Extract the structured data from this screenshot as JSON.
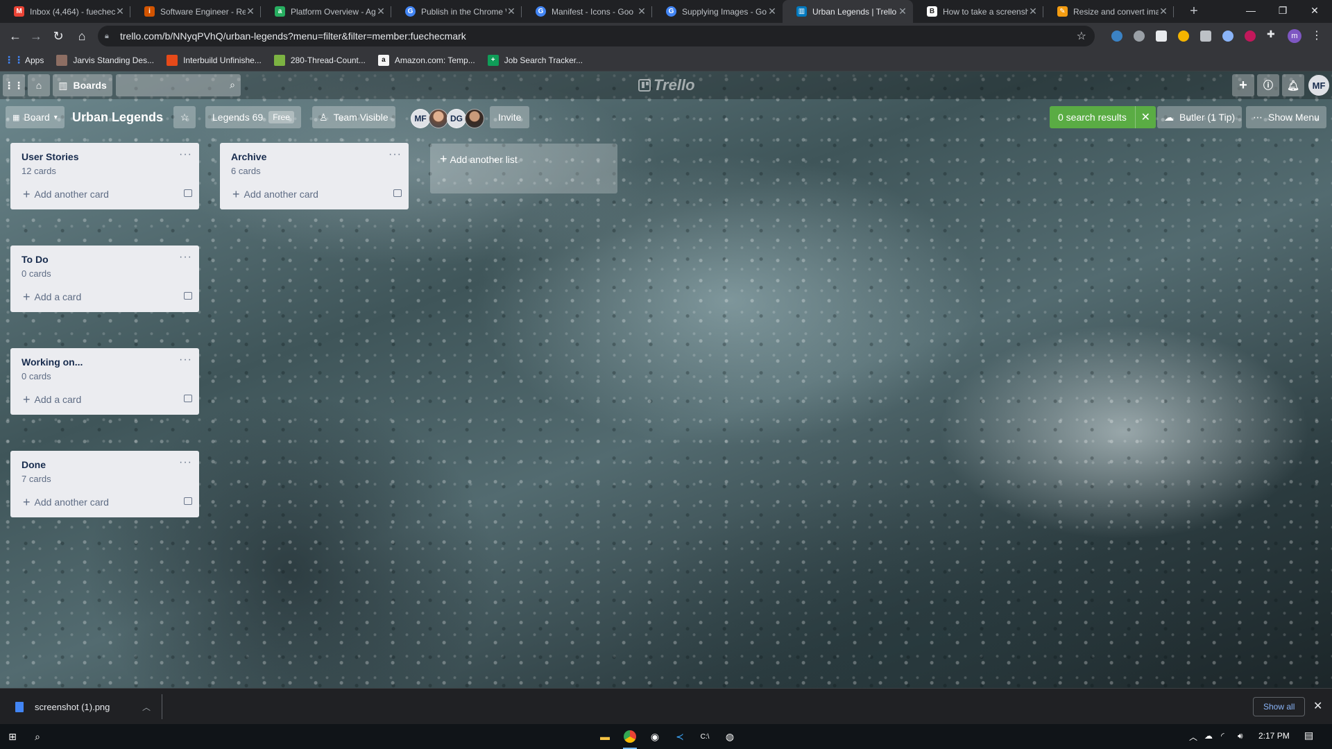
{
  "browser": {
    "tabs": [
      {
        "title": "Inbox (4,464) - fuechec",
        "favicon": "gmail-icon",
        "color": "#ea4335"
      },
      {
        "title": "Software Engineer - Re",
        "favicon": "indeed-icon",
        "color": "#d35400"
      },
      {
        "title": "Platform Overview - Ag",
        "favicon": "agora-icon",
        "color": "#27ae60"
      },
      {
        "title": "Publish in the Chrome W",
        "favicon": "google-icon",
        "color": "#4285f4"
      },
      {
        "title": "Manifest - Icons - Goo",
        "favicon": "google-icon",
        "color": "#4285f4"
      },
      {
        "title": "Supplying Images - Go",
        "favicon": "google-icon",
        "color": "#4285f4"
      },
      {
        "title": "Urban Legends | Trello",
        "favicon": "trello-icon",
        "color": "#0079bf"
      },
      {
        "title": "How to take a screensh",
        "favicon": "bi-icon",
        "color": "#222222"
      },
      {
        "title": "Resize and convert ima",
        "favicon": "pin-icon",
        "color": "#f39c12"
      }
    ],
    "active_tab": 6,
    "url": "trello.com/b/NNyqPVhQ/urban-legends?menu=filter&filter=member:fuechecmark",
    "profile_initial": "m",
    "bookmarks": [
      {
        "label": "Apps",
        "icon": "apps-grid-icon",
        "color": "#4285f4"
      },
      {
        "label": "Jarvis Standing Des...",
        "icon": "jarvis-icon",
        "color": "#8d6e63"
      },
      {
        "label": "Interbuild Unfinishe...",
        "icon": "interbuild-icon",
        "color": "#e64a19"
      },
      {
        "label": "280-Thread-Count...",
        "icon": "thread-icon",
        "color": "#7cb342"
      },
      {
        "label": "Amazon.com: Temp...",
        "icon": "amazon-icon",
        "color": "#f5f5f5"
      },
      {
        "label": "Job Search Tracker...",
        "icon": "sheets-icon",
        "color": "#0f9d58"
      }
    ]
  },
  "trello": {
    "header": {
      "boards_label": "Boards",
      "search_placeholder": "",
      "logo_text": "Trello",
      "avatar_initials": "MF"
    },
    "boardbar": {
      "view_label": "Board",
      "title": "Urban Legends",
      "team_label": "Legends 69",
      "plan_badge": "Free",
      "visibility_label": "Team Visible",
      "members": [
        {
          "initials": "MF",
          "kind": "initials"
        },
        {
          "initials": "",
          "kind": "photo"
        },
        {
          "initials": "DG",
          "kind": "initials"
        },
        {
          "initials": "",
          "kind": "photo"
        }
      ],
      "invite_label": "Invite",
      "search_results_label": "0 search results",
      "butler_label": "Butler (1 Tip)",
      "show_menu_label": "Show Menu"
    },
    "lists": [
      {
        "title": "User Stories",
        "count": "12 cards",
        "add_label": "Add another card"
      },
      {
        "title": "Archive",
        "count": "6 cards",
        "add_label": "Add another card"
      },
      {
        "title": "To Do",
        "count": "0 cards",
        "add_label": "Add a card"
      },
      {
        "title": "Working on...",
        "count": "0 cards",
        "add_label": "Add a card"
      },
      {
        "title": "Done",
        "count": "7 cards",
        "add_label": "Add another card"
      }
    ],
    "add_list_label": "Add another list"
  },
  "download_shelf": {
    "file_name": "screenshot (1).png",
    "show_all_label": "Show all"
  },
  "taskbar": {
    "time": "2:17 PM"
  }
}
